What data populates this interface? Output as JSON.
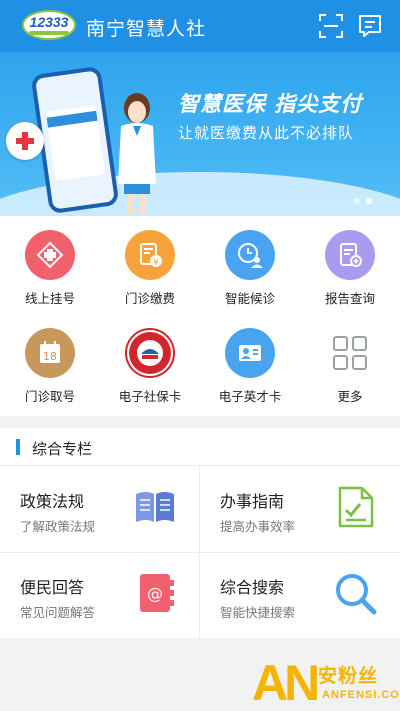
{
  "header": {
    "logo_text": "12333",
    "title": "南宁智慧人社",
    "scan_icon": "scan-icon",
    "message_icon": "message-icon"
  },
  "banner": {
    "headline": "智慧医保  指尖支付",
    "subline": "让就医缴费从此不必排队",
    "page_count": 2,
    "active_page": 2
  },
  "functions": [
    {
      "label": "线上挂号",
      "icon": "medical-cross-icon",
      "color": "#f0616d"
    },
    {
      "label": "门诊缴费",
      "icon": "payment-doc-icon",
      "color": "#f7a23b"
    },
    {
      "label": "智能候诊",
      "icon": "clock-user-icon",
      "color": "#4aa3f0"
    },
    {
      "label": "报告查询",
      "icon": "report-search-icon",
      "color": "#a99cf0"
    },
    {
      "label": "门诊取号",
      "icon": "calendar-icon",
      "color": "#c8975a",
      "badge": "18"
    },
    {
      "label": "电子社保卡",
      "icon": "social-security-seal-icon",
      "color": "#d2262d"
    },
    {
      "label": "电子英才卡",
      "icon": "id-card-icon",
      "color": "#4aa3f0"
    },
    {
      "label": "更多",
      "icon": "grid-more-icon",
      "color": "#9aa0a6"
    }
  ],
  "section": {
    "title": "综合专栏",
    "tiles": [
      {
        "title": "政策法规",
        "subtitle": "了解政策法规",
        "icon": "book-icon",
        "color": "#5b7bd5"
      },
      {
        "title": "办事指南",
        "subtitle": "提高办事效率",
        "icon": "checklist-doc-icon",
        "color": "#7bc043"
      },
      {
        "title": "便民回答",
        "subtitle": "常见问题解答",
        "icon": "address-book-icon",
        "color": "#f0616d"
      },
      {
        "title": "综合搜索",
        "subtitle": "智能快捷搜索",
        "icon": "search-icon",
        "color": "#4aa3f0"
      }
    ]
  },
  "watermark": {
    "mark": "AN",
    "name": "安粉丝",
    "domain": "ANFENSI.COM"
  }
}
